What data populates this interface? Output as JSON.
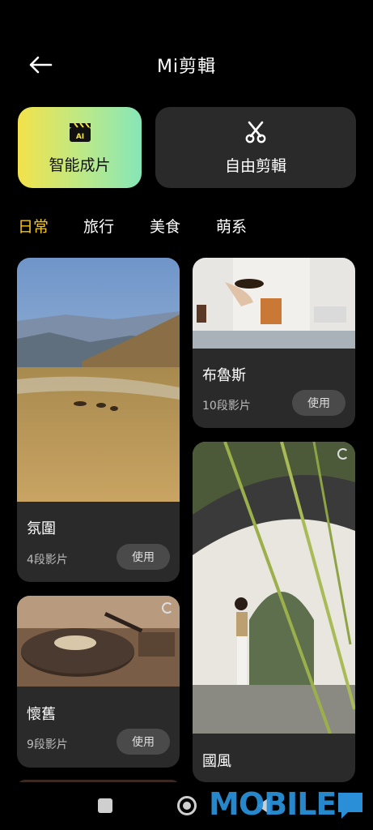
{
  "header": {
    "title": "Mi剪輯",
    "back_icon": "arrow-left-icon"
  },
  "actions": {
    "ai_label": "智能成片",
    "ai_icon": "ai-clapperboard-icon",
    "free_label": "自由剪輯",
    "free_icon": "scissors-icon"
  },
  "tabs": [
    {
      "label": "日常",
      "active": true
    },
    {
      "label": "旅行",
      "active": false
    },
    {
      "label": "美食",
      "active": false
    },
    {
      "label": "萌系",
      "active": false
    }
  ],
  "templates": [
    {
      "name": "氛圍",
      "count": "4段影片",
      "use_label": "使用"
    },
    {
      "name": "懷舊",
      "count": "9段影片",
      "use_label": "使用"
    },
    {
      "name": "布魯斯",
      "count": "10段影片",
      "use_label": "使用"
    },
    {
      "name": "國風",
      "count": "",
      "use_label": ""
    }
  ],
  "watermark": "MOBILE",
  "colors": {
    "accent": "#f5c518",
    "card_bg": "#2a2a2a",
    "use_btn_bg": "#4a4a4a"
  }
}
